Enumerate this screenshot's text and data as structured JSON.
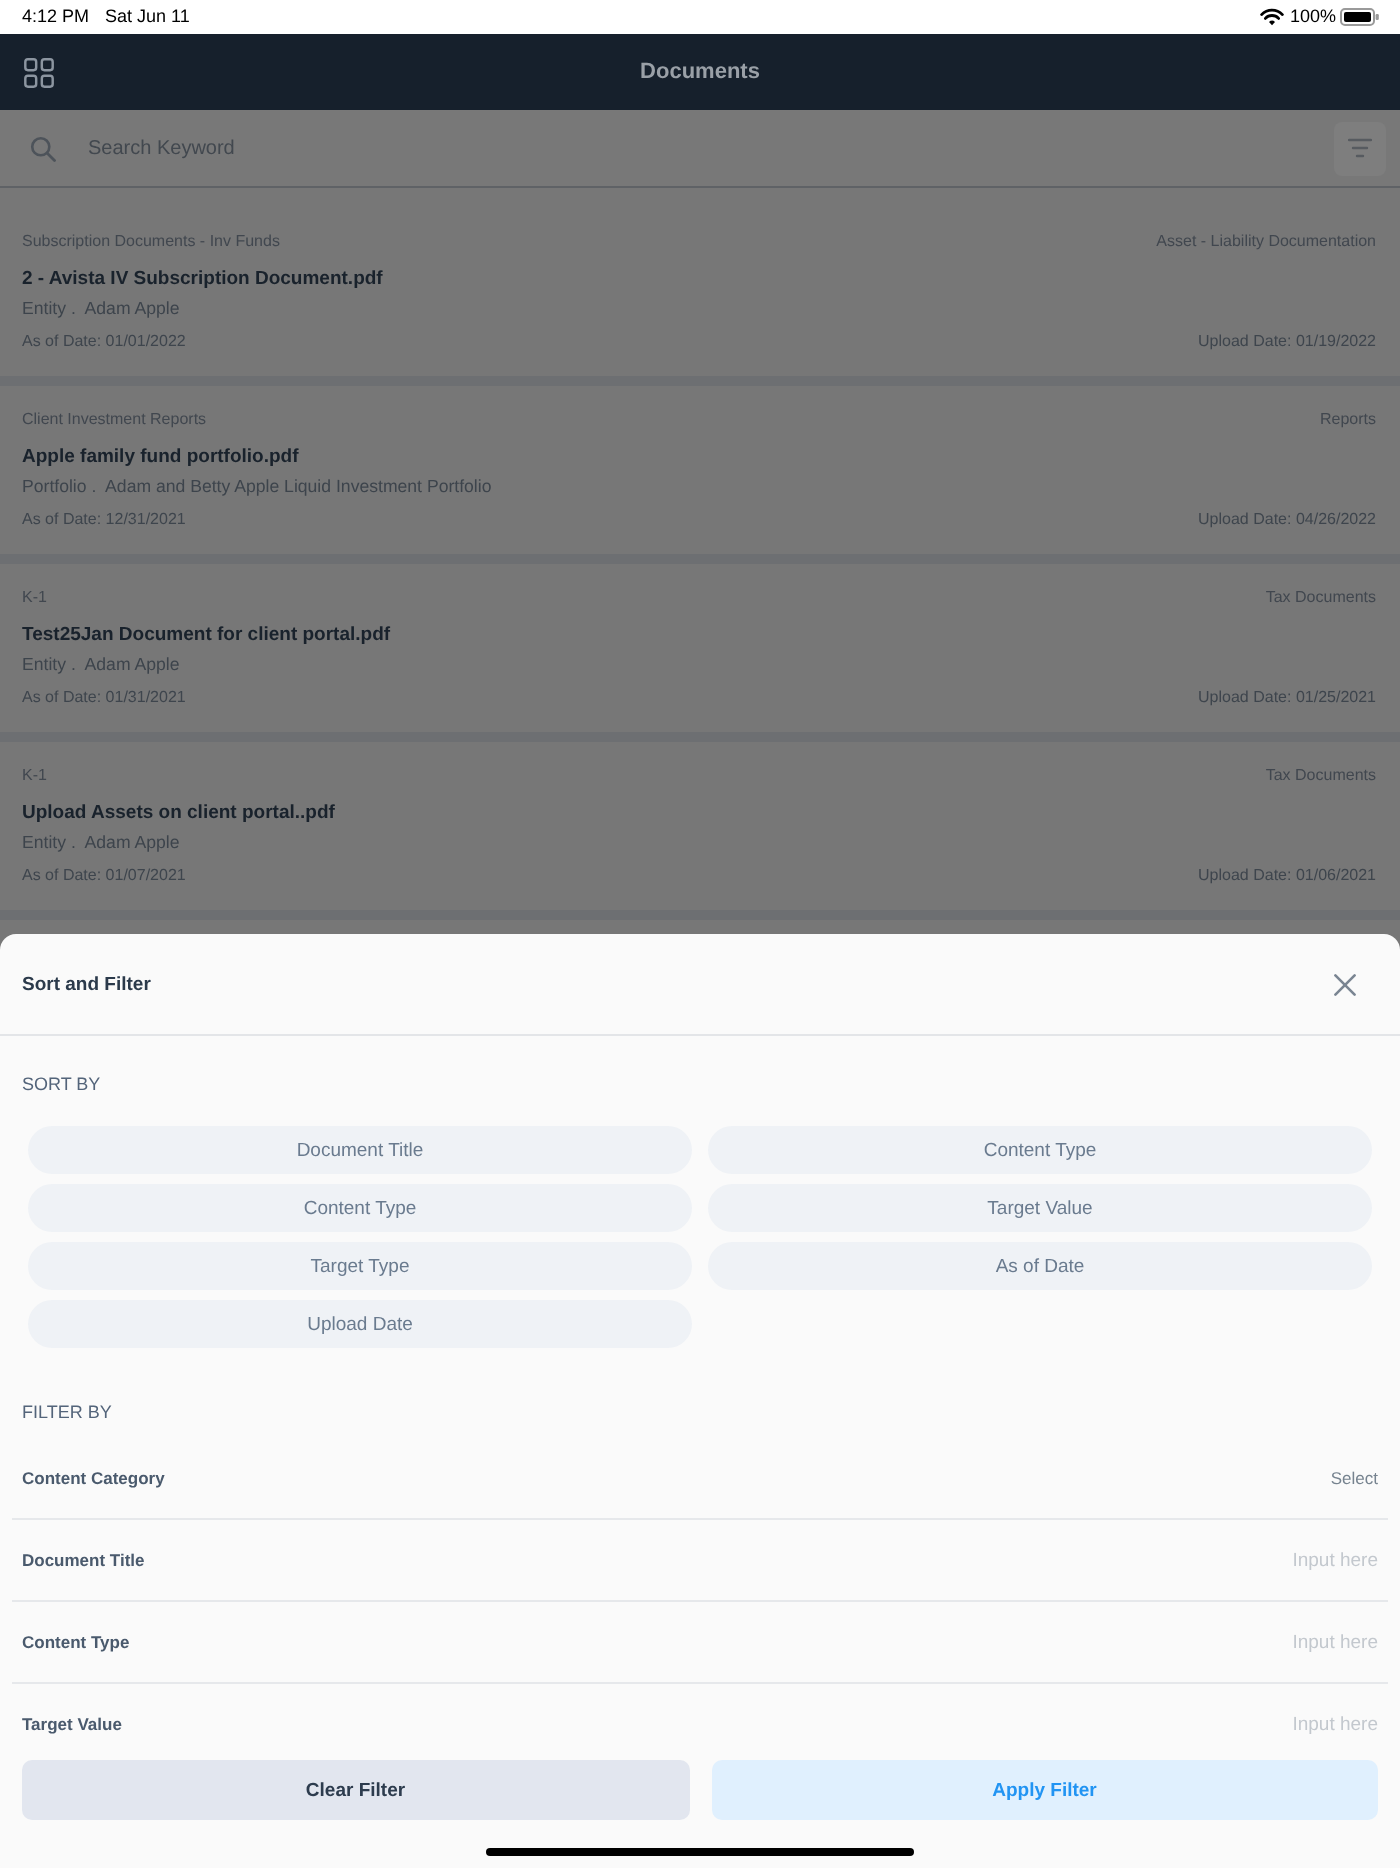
{
  "status_bar": {
    "time": "4:12 PM",
    "date": "Sat Jun 11",
    "battery": "100%"
  },
  "header": {
    "title": "Documents"
  },
  "search": {
    "placeholder": "Search Keyword"
  },
  "documents": [
    {
      "category": "Subscription Documents - Inv Funds",
      "type": "Asset - Liability Documentation",
      "title": "2 - Avista IV Subscription Document.pdf",
      "owner": "Entity .  Adam Apple",
      "as_of_date": "As of Date: 01/01/2022",
      "upload_date": "Upload Date: 01/19/2022"
    },
    {
      "category": "Client Investment Reports",
      "type": "Reports",
      "title": "Apple family fund portfolio.pdf",
      "owner": "Portfolio .  Adam and Betty Apple Liquid Investment Portfolio",
      "as_of_date": "As of Date: 12/31/2021",
      "upload_date": "Upload Date: 04/26/2022"
    },
    {
      "category": "K-1",
      "type": "Tax Documents",
      "title": "Test25Jan Document for client portal.pdf",
      "owner": "Entity .  Adam Apple",
      "as_of_date": "As of Date: 01/31/2021",
      "upload_date": "Upload Date: 01/25/2021"
    },
    {
      "category": "K-1",
      "type": "Tax Documents",
      "title": "Upload Assets on client portal..pdf",
      "owner": "Entity .  Adam Apple",
      "as_of_date": "As of Date: 01/07/2021",
      "upload_date": "Upload Date: 01/06/2021"
    }
  ],
  "sort_filter": {
    "title": "Sort and Filter",
    "sort_heading": "SORT BY",
    "sort_options": [
      {
        "label": "Document Title",
        "selected": false
      },
      {
        "label": "Content Type",
        "selected": false
      },
      {
        "label": "Content Type",
        "selected": false
      },
      {
        "label": "Target Value",
        "selected": false
      },
      {
        "label": "Target Type",
        "selected": false
      },
      {
        "label": "As of Date",
        "selected": false
      },
      {
        "label": "Upload Date",
        "selected": false
      }
    ],
    "filter_heading": "FILTER BY",
    "filters": [
      {
        "kind": "select",
        "label": "Content Category",
        "placeholder": "Select"
      },
      {
        "kind": "input",
        "label": "Document Title",
        "placeholder": "Input here"
      },
      {
        "kind": "input",
        "label": "Content Type",
        "placeholder": "Input here"
      },
      {
        "kind": "input",
        "label": "Target Value",
        "placeholder": "Input here"
      }
    ],
    "buttons": [
      {
        "kind": "secondary",
        "label": "Clear Filter"
      },
      {
        "kind": "primary",
        "label": "Apply Filter"
      }
    ]
  }
}
